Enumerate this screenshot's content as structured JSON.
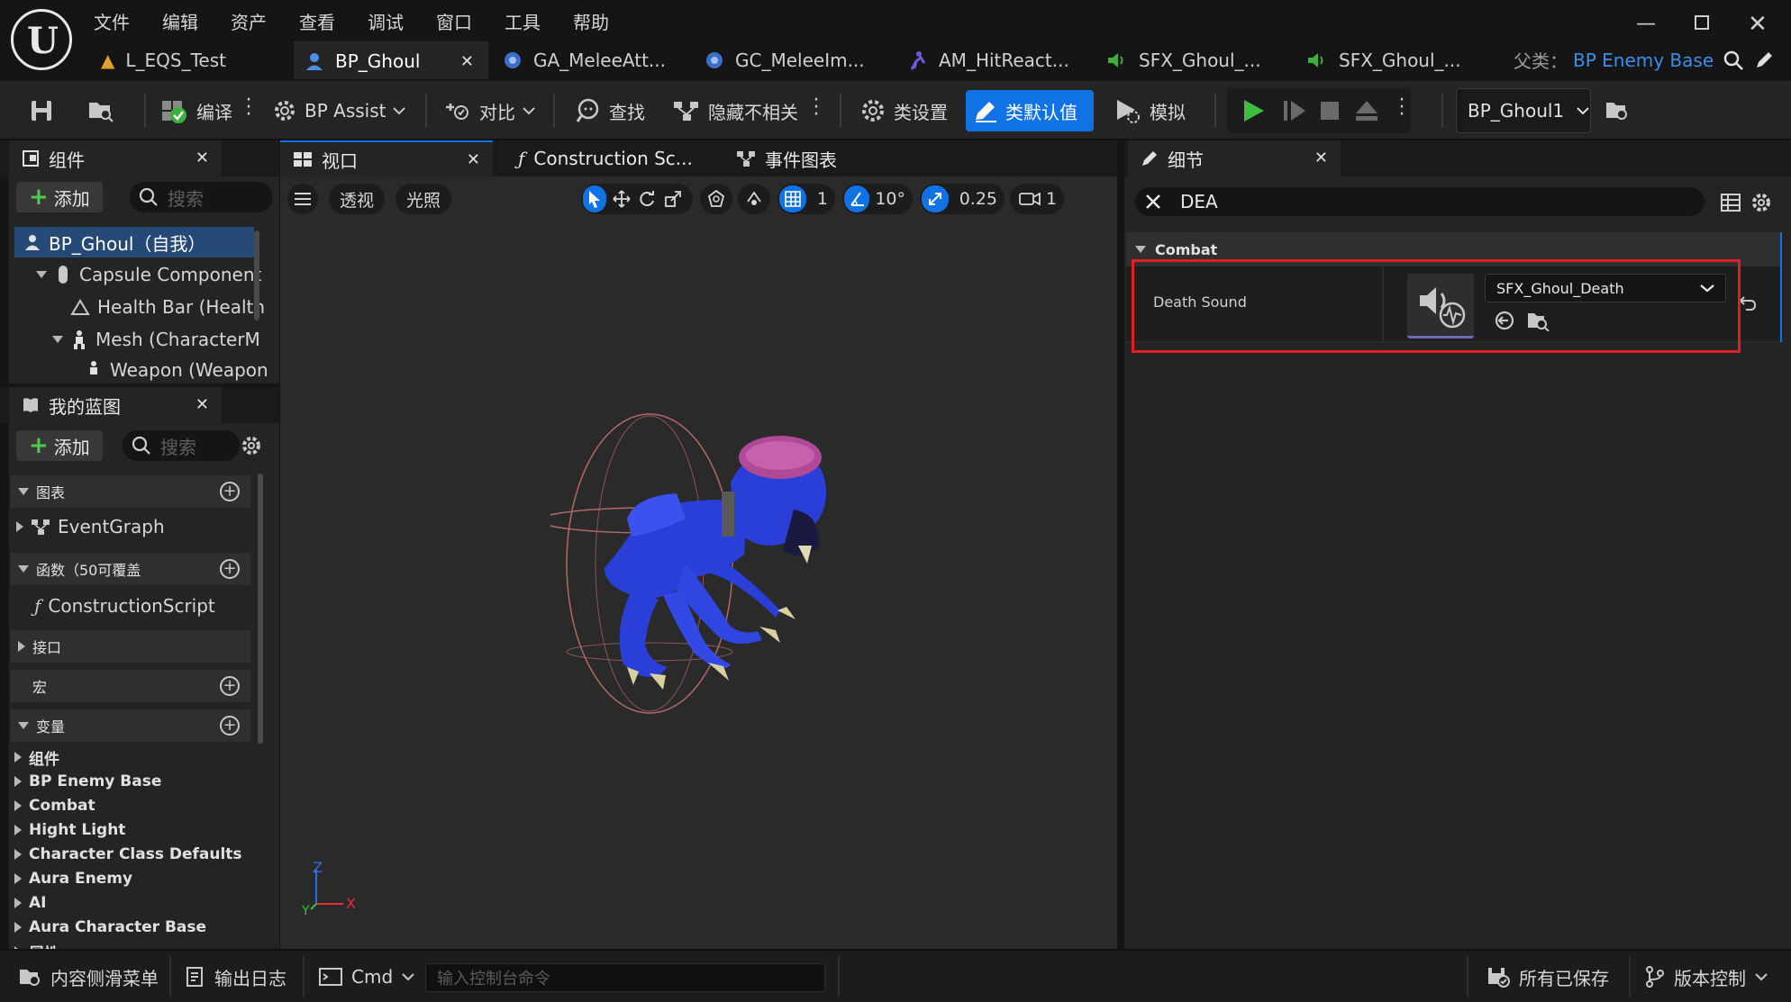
{
  "app": {
    "menu": [
      "文件",
      "编辑",
      "资产",
      "查看",
      "调试",
      "窗口",
      "工具",
      "帮助"
    ],
    "logo_icon": "unreal-logo"
  },
  "doc_tabs": [
    {
      "label": "L_EQS_Test",
      "icon": "level-icon",
      "active": false
    },
    {
      "label": "BP_Ghoul",
      "icon": "blueprint-icon",
      "active": true
    },
    {
      "label": "GA_MeleeAtt...",
      "icon": "gameplay-ability-icon",
      "active": false
    },
    {
      "label": "GC_MeleeIm...",
      "icon": "gameplay-cue-icon",
      "active": false
    },
    {
      "label": "AM_HitReact...",
      "icon": "anim-montage-icon",
      "active": false
    },
    {
      "label": "SFX_Ghoul_...",
      "icon": "sound-icon",
      "active": false
    },
    {
      "label": "SFX_Ghoul_...",
      "icon": "sound-icon",
      "active": false
    }
  ],
  "parent_class": {
    "label": "父类：",
    "value": "BP Enemy Base"
  },
  "toolbar": {
    "compile": "编译",
    "bp_assist": "BP Assist",
    "diff": "对比",
    "find": "查找",
    "hide_unrelated": "隐藏不相关",
    "class_settings": "类设置",
    "class_defaults": "类默认值",
    "simulate": "模拟",
    "debug_object": "BP_Ghoul1",
    "accent": "#0f73e6",
    "play_color": "#3fbf3f"
  },
  "components_panel": {
    "title": "组件",
    "add": "添加",
    "search_placeholder": "搜索",
    "items": [
      {
        "label": "BP_Ghoul（自我）",
        "indent": 0,
        "selected": true
      },
      {
        "label": "Capsule Component",
        "indent": 1
      },
      {
        "label": "Health Bar (Health",
        "indent": 2
      },
      {
        "label": "Mesh (CharacterM",
        "indent": 2
      },
      {
        "label": "Weapon (Weapon",
        "indent": 3
      }
    ]
  },
  "my_blueprint": {
    "title": "我的蓝图",
    "add": "添加",
    "search_placeholder": "搜索",
    "sections": {
      "graphs": "图表",
      "event_graph": "EventGraph",
      "functions": "函数（50可覆盖",
      "construction_script": "ConstructionScript",
      "interfaces": "接口",
      "macros": "宏",
      "variables": "变量"
    },
    "variable_categories": [
      "组件",
      "BP Enemy Base",
      "Combat",
      "Hight Light",
      "Character Class Defaults",
      "Aura Enemy",
      "AI",
      "Aura Character Base",
      "属性"
    ]
  },
  "editor_tabs": {
    "viewport": "视口",
    "construction_script": "Construction Sc...",
    "event_graph": "事件图表"
  },
  "viewport": {
    "perspective": "透视",
    "lit": "光照",
    "grid_size": "1",
    "rotation_snap": "10°",
    "scale_snap": "0.25",
    "camera_speed": "1",
    "axis_z": "Z",
    "axis_x": "X",
    "axis_y": "Y"
  },
  "details": {
    "title": "细节",
    "search_value": "DEA",
    "section": "Combat",
    "property_label": "Death Sound",
    "property_value": "SFX_Ghoul_Death",
    "highlight_color": "#e02020"
  },
  "status_bar": {
    "content_drawer": "内容侧滑菜单",
    "output_log": "输出日志",
    "cmd": "Cmd",
    "console_placeholder": "输入控制台命令",
    "all_saved": "所有已保存",
    "source_control": "版本控制"
  }
}
